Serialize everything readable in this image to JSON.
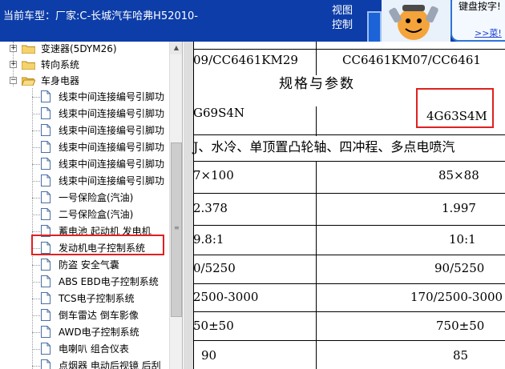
{
  "topbar": {
    "vehicle_label": "当前车型：厂家:C-长城汽车哈弗H52010-",
    "view_control": "视图控制",
    "help_bubble_text": "键盘按字!",
    "help_bubble_link": ">>菜!"
  },
  "tree": {
    "items": [
      {
        "label": "变速器(5DYM26)",
        "type": "folder",
        "expander": "+"
      },
      {
        "label": "转向系统",
        "type": "folder",
        "expander": "+"
      },
      {
        "label": "车身电器",
        "type": "folder-open",
        "expander": "−"
      },
      {
        "label": "线束中间连接编号引脚功",
        "type": "doc"
      },
      {
        "label": "线束中间连接编号引脚功",
        "type": "doc"
      },
      {
        "label": "线束中间连接编号引脚功",
        "type": "doc"
      },
      {
        "label": "线束中间连接编号引脚功",
        "type": "doc"
      },
      {
        "label": "线束中间连接编号引脚功",
        "type": "doc"
      },
      {
        "label": "线束中间连接编号引脚功",
        "type": "doc"
      },
      {
        "label": "一号保险盒(汽油)",
        "type": "doc"
      },
      {
        "label": "二号保险盒(汽油)",
        "type": "doc"
      },
      {
        "label": "蓄电池 起动机 发电机",
        "type": "doc"
      },
      {
        "label": "发动机电子控制系统",
        "type": "doc",
        "highlighted": true
      },
      {
        "label": "防盗 安全气囊",
        "type": "doc"
      },
      {
        "label": "ABS EBD电子控制系统",
        "type": "doc"
      },
      {
        "label": "TCS电子控制系统",
        "type": "doc"
      },
      {
        "label": "倒车雷达 倒车影像",
        "type": "doc"
      },
      {
        "label": "AWD电子控制系统",
        "type": "doc"
      },
      {
        "label": "电喇叭 组合仪表",
        "type": "doc"
      },
      {
        "label": "点烟器 电动后视镜 后刮",
        "type": "doc"
      }
    ]
  },
  "document": {
    "header_left": "09/CC6461KM29",
    "header_right": "CC6461KM07/CC6461",
    "section_title": "规格与参数",
    "rows": [
      {
        "left": "G69S4N",
        "right": "4G63S4M",
        "right_highlighted": true
      },
      {
        "span": "J、水冷、单顶置凸轮轴、四冲程、多点电喷汽"
      },
      {
        "left": "7×100",
        "right": "85×88"
      },
      {
        "left": "2.378",
        "right": "1.997"
      },
      {
        "left": "9.8:1",
        "right": "10:1"
      },
      {
        "left": "0/5250",
        "right": "90/5250"
      },
      {
        "left": "2500-3000",
        "right": "170/2500-3000"
      },
      {
        "left": "50±50",
        "right": "750±50"
      },
      {
        "left": "90",
        "right": "85"
      }
    ]
  },
  "colors": {
    "topbar": "#0d3da8",
    "highlight": "#e02020",
    "link": "#1a3fd0"
  },
  "icons": [
    "folder-icon",
    "document-icon",
    "expand-icon",
    "collapse-icon",
    "mascot-icon",
    "scroll-up-arrow-icon"
  ]
}
